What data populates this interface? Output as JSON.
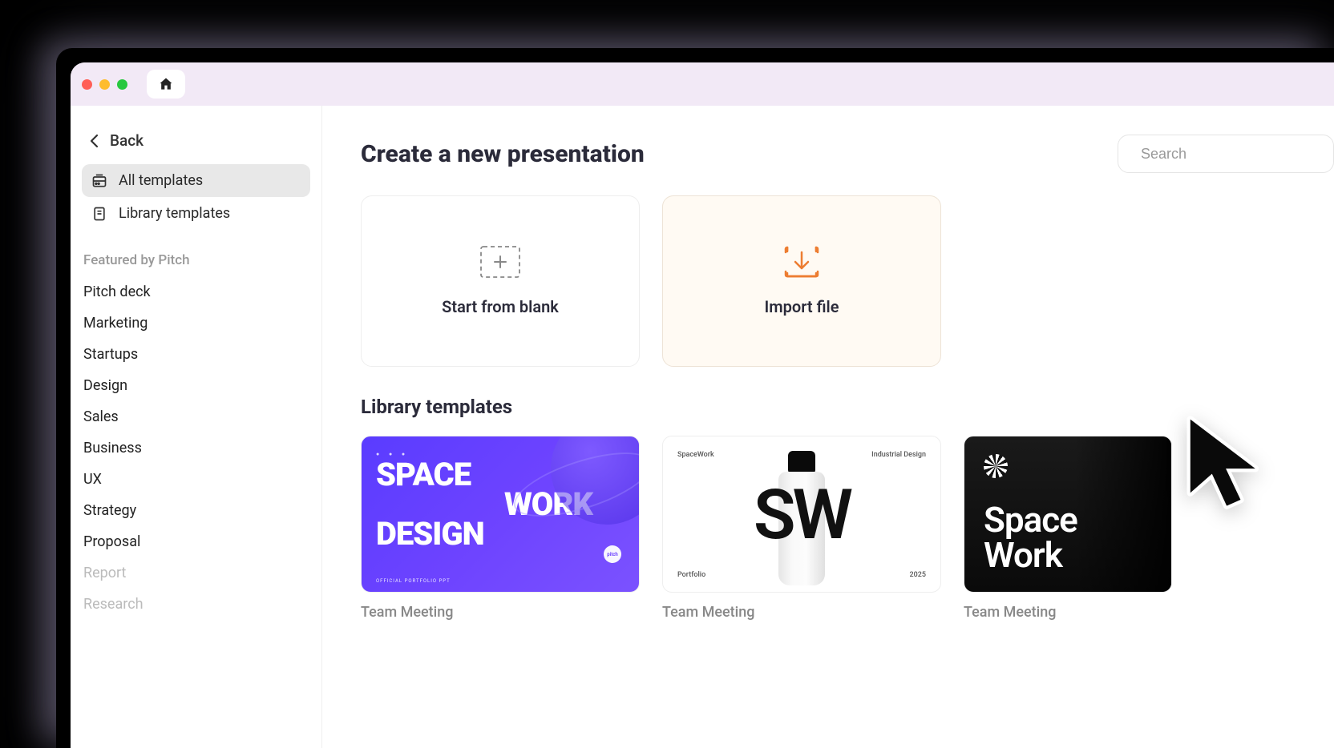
{
  "titleBar": {
    "homeTooltip": "Home"
  },
  "sidebar": {
    "back": "Back",
    "allTemplates": "All templates",
    "libraryTemplates": "Library templates",
    "featuredLabel": "Featured by Pitch",
    "categories": {
      "c0": "Pitch deck",
      "c1": "Marketing",
      "c2": "Startups",
      "c3": "Design",
      "c4": "Sales",
      "c5": "Business",
      "c6": "UX",
      "c7": "Strategy",
      "c8": "Proposal",
      "c9": "Report",
      "c10": "Research"
    }
  },
  "main": {
    "title": "Create a new presentation",
    "searchPlaceholder": "Search",
    "actions": {
      "blank": "Start from blank",
      "import": "Import file"
    },
    "librarySectionTitle": "Library templates",
    "templates": {
      "t1": {
        "caption": "Team Meeting",
        "line1": "SPACE",
        "line2": "WORK",
        "line3": "DESIGN",
        "tiny": "OFFICIAL PORTFOLIO PPT",
        "circleTxt": "pitch"
      },
      "t2": {
        "caption": "Team Meeting",
        "tl": "SpaceWork",
        "tr": "Industrial Design",
        "bl": "Portfolio",
        "br": "2025",
        "center": "SW"
      },
      "t3": {
        "caption": "Team Meeting",
        "line1": "Space",
        "line2": "Work"
      }
    }
  }
}
